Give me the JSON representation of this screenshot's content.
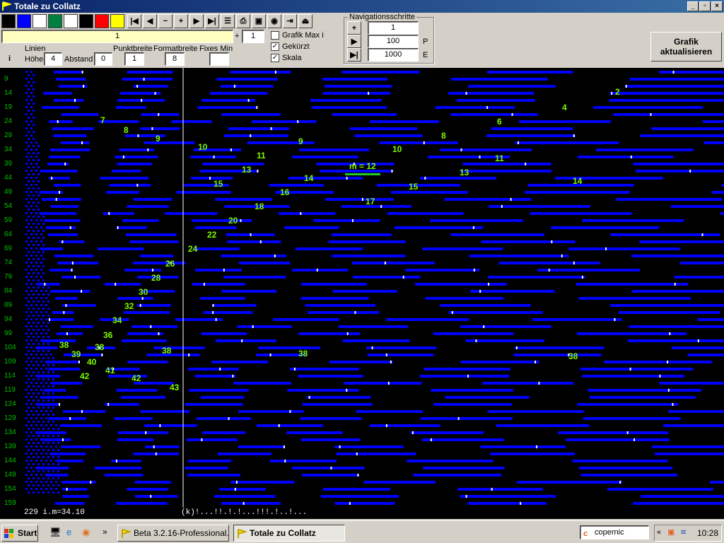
{
  "window": {
    "title": "Totale zu Collatz"
  },
  "toolbar": {
    "swatches": [
      "#000000",
      "#0000ff",
      "#ffffff",
      "#008040",
      "#ffffff",
      "#000000",
      "#ff0000",
      "#ffff00"
    ],
    "nav_icons": [
      "first-icon",
      "prev-icon",
      "minus-icon",
      "plus-icon",
      "next-icon",
      "last-icon",
      "grid-icon",
      "print-icon",
      "save-icon",
      "camera-icon",
      "exit-icon"
    ],
    "range_value": "1",
    "plus_sign": "+",
    "step_value": "1",
    "chk_grafik_max": "Grafik Max i",
    "chk_gekuerzt": "Gekürzt",
    "chk_skala": "Skala"
  },
  "params": {
    "i_label": "i",
    "linien_label": "Linien",
    "hoehe_label": "Höhe",
    "hoehe_value": "4",
    "abstand_label": "Abstand",
    "abstand_value": "0",
    "punktbreite_label": "Punktbreite",
    "punktbreite_value": "1",
    "formatbreite_label": "Formatbreite",
    "formatbreite_value": "8",
    "fixes_min_label": "Fixes Min",
    "fixes_min_value": ""
  },
  "navigation": {
    "title": "Navigationsschritte",
    "plus_value": "1",
    "p_value": "100",
    "p_label": "P",
    "e_value": "1000",
    "e_label": "E"
  },
  "refresh_button": {
    "line1": "Grafik",
    "line2": "aktualisieren"
  },
  "canvas": {
    "row_labels": [
      "9",
      "14",
      "19",
      "24",
      "29",
      "34",
      "39",
      "44",
      "49",
      "54",
      "59",
      "64",
      "69",
      "74",
      "79",
      "84",
      "89",
      "94",
      "99",
      "104",
      "109",
      "114",
      "119",
      "124",
      "129",
      "134",
      "139",
      "144",
      "149",
      "154",
      "159"
    ],
    "annotation": "m = 12",
    "numbers": [
      "2",
      "4",
      "6",
      "7",
      "8",
      "8",
      "9",
      "9",
      "10",
      "10",
      "11",
      "11",
      "13",
      "13",
      "14",
      "14",
      "15",
      "15",
      "16",
      "17",
      "18",
      "20",
      "22",
      "24",
      "26",
      "28",
      "30",
      "32",
      "34",
      "36",
      "38",
      "38",
      "38",
      "38",
      "38",
      "39",
      "40",
      "41",
      "42",
      "42",
      "43"
    ],
    "colors": {
      "bar": "#0000ff",
      "number": "#7cfc00",
      "label": "#00c000",
      "marker": "#22cc22"
    }
  },
  "statusline": {
    "left": "229 i.m=34.10",
    "right": "(k)!...!!.!.!...!!!.!..!..."
  },
  "taskbar": {
    "start": "Start",
    "task1": "Beta 3.2.16-Professional...",
    "task2": "Totale zu Collatz",
    "search": "copernic",
    "clock": "10:28"
  }
}
